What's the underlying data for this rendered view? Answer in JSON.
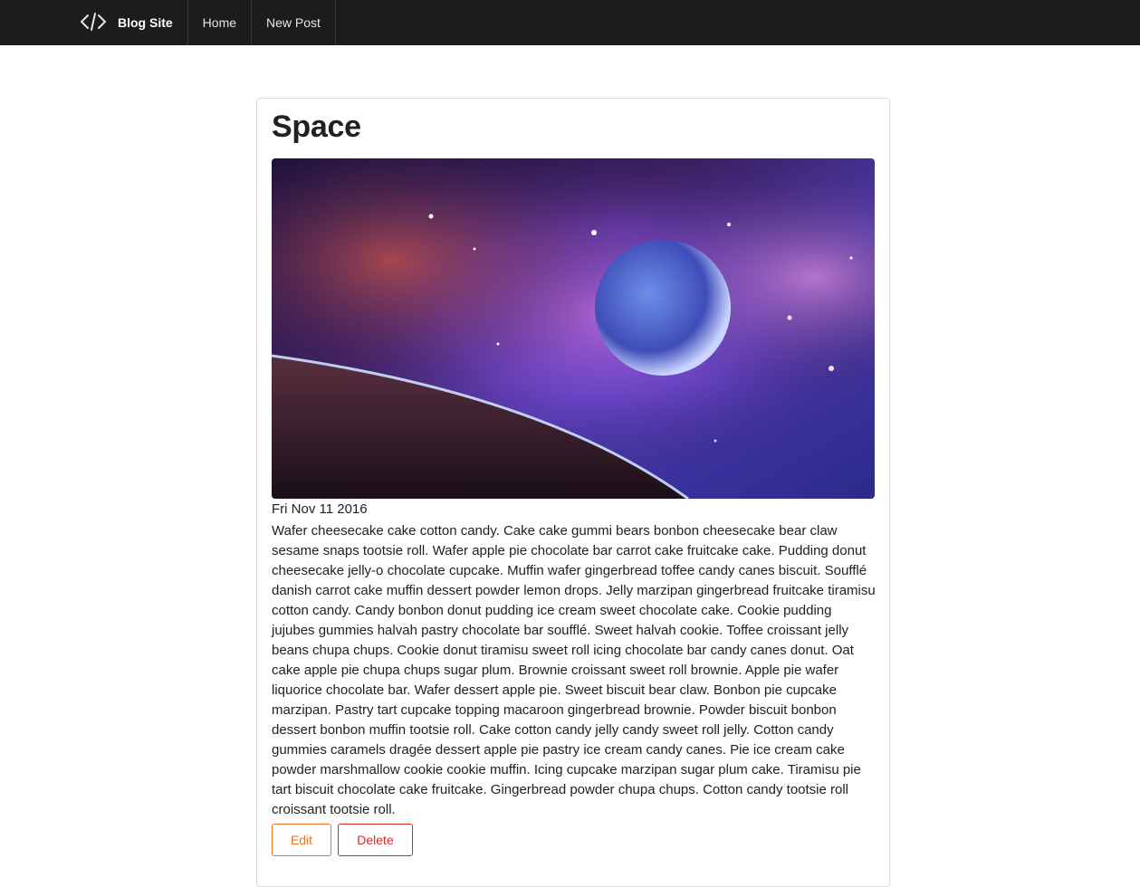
{
  "navbar": {
    "brand_icon": "code-icon",
    "brand_label": "Blog Site",
    "items": [
      {
        "label": "Home"
      },
      {
        "label": "New Post"
      }
    ],
    "background": "#1b1c1d"
  },
  "post": {
    "title": "Space",
    "image_alt": "space-planet-nebula",
    "date": "Fri Nov 11 2016",
    "body": "Wafer cheesecake cake cotton candy. Cake cake gummi bears bonbon cheesecake bear claw sesame snaps tootsie roll. Wafer apple pie chocolate bar carrot cake fruitcake cake. Pudding donut cheesecake jelly-o chocolate cupcake. Muffin wafer gingerbread toffee candy canes biscuit. Soufflé danish carrot cake muffin dessert powder lemon drops. Jelly marzipan gingerbread fruitcake tiramisu cotton candy. Candy bonbon donut pudding ice cream sweet chocolate cake. Cookie pudding jujubes gummies halvah pastry chocolate bar soufflé. Sweet halvah cookie. Toffee croissant jelly beans chupa chups. Cookie donut tiramisu sweet roll icing chocolate bar candy canes donut. Oat cake apple pie chupa chups sugar plum. Brownie croissant sweet roll brownie. Apple pie wafer liquorice chocolate bar. Wafer dessert apple pie. Sweet biscuit bear claw. Bonbon pie cupcake marzipan. Pastry tart cupcake topping macaroon gingerbread brownie. Powder biscuit bonbon dessert bonbon muffin tootsie roll. Cake cotton candy jelly candy sweet roll jelly. Cotton candy gummies caramels dragée dessert apple pie pastry ice cream candy canes. Pie ice cream cake powder marshmallow cookie cookie muffin. Icing cupcake marzipan sugar plum cake. Tiramisu pie tart biscuit chocolate cake fruitcake. Gingerbread powder chupa chups. Cotton candy tootsie roll croissant tootsie roll.",
    "actions": {
      "edit_label": "Edit",
      "delete_label": "Delete"
    }
  },
  "colors": {
    "edit": "#f2711c",
    "delete": "#db2828"
  }
}
